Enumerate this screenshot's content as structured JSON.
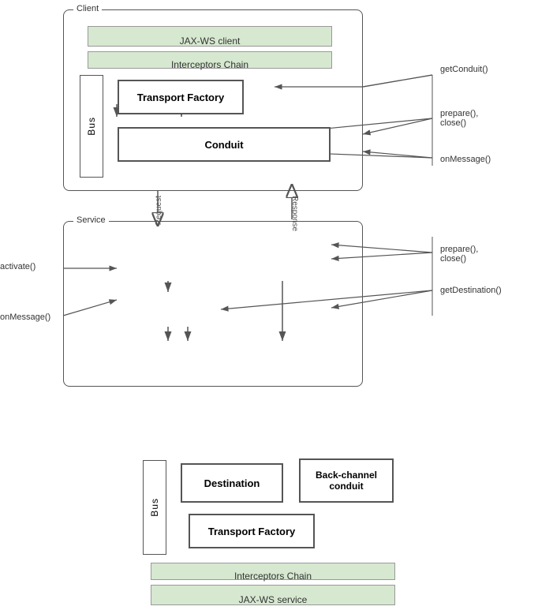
{
  "diagram": {
    "client": {
      "label": "Client",
      "jaxws_bar": "JAX-WS client",
      "interceptors_bar": "Interceptors Chain",
      "bus_label": "Bus",
      "transport_factory_label": "Transport Factory",
      "conduit_label": "Conduit"
    },
    "service": {
      "label": "Service",
      "jaxws_bar": "JAX-WS service",
      "interceptors_bar": "Interceptors Chain",
      "bus_label": "Bus",
      "destination_label": "Destination",
      "backchannel_label": "Back-channel\nconduit",
      "transport_factory_label": "Transport Factory"
    },
    "annotations": {
      "getConduit": "getConduit()",
      "prepareClosed_top": "prepare(),\nclose()",
      "onMessage_top": "onMessage()",
      "activate": "activate()",
      "prepareClose_bottom": "prepare(),\nclose()",
      "getDestination": "getDestination()",
      "onMessage_bottom": "onMessage()",
      "request": "Request",
      "response": "Response"
    }
  }
}
